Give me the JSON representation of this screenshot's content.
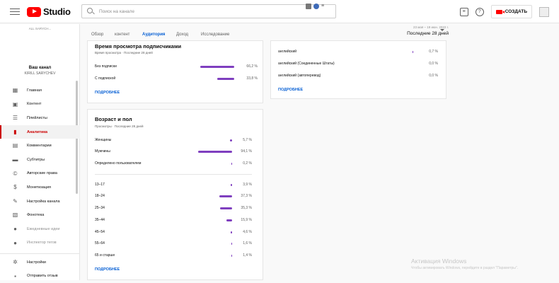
{
  "topbar": {
    "logo_text": "Studio",
    "search_placeholder": "Поиск на канале",
    "create_label": "СОЗДАТЬ"
  },
  "sidebar": {
    "banner_text": "ALL SARYCH...",
    "channel_title": "Ваш канал",
    "channel_name": "KIRILL SARYCHEV",
    "items": [
      {
        "label": "Главная",
        "icon": "dashboard-icon"
      },
      {
        "label": "Контент",
        "icon": "content-icon"
      },
      {
        "label": "Плейлисты",
        "icon": "playlist-icon"
      },
      {
        "label": "Аналитика",
        "icon": "analytics-icon",
        "active": true
      },
      {
        "label": "Комментарии",
        "icon": "comments-icon"
      },
      {
        "label": "Субтитры",
        "icon": "subtitles-icon"
      },
      {
        "label": "Авторские права",
        "icon": "copyright-icon"
      },
      {
        "label": "Монетизация",
        "icon": "monetization-icon"
      },
      {
        "label": "Настройка канала",
        "icon": "customization-icon"
      },
      {
        "label": "Фонотека",
        "icon": "audio-library-icon"
      },
      {
        "label": "Ежедневные идеи",
        "icon": "ideas-icon",
        "dim": true
      },
      {
        "label": "Инспектор тегов",
        "icon": "tag-inspector-icon",
        "dim": true
      }
    ],
    "bottom_items": [
      {
        "label": "Настройки",
        "icon": "settings-icon"
      },
      {
        "label": "Отправить отзыв",
        "icon": "feedback-icon"
      }
    ]
  },
  "tabs": [
    "Обзор",
    "контент",
    "Аудитория",
    "Доход",
    "Исследование"
  ],
  "active_tab": "Аудитория",
  "period": {
    "range": "23 мая – 19 июн. 2022 г.",
    "value": "Последние 28 дней"
  },
  "card_subscribers": {
    "title": "Время просмотра подписчиками",
    "subtitle": "Время просмотра · Последние 28 дней",
    "rows": [
      {
        "label": "Без подписки",
        "value": "66,2 %",
        "fraction": 0.662
      },
      {
        "label": "С подпиской",
        "value": "33,8 %",
        "fraction": 0.338
      }
    ],
    "more": "ПОДРОБНЕЕ"
  },
  "card_subtitles": {
    "rows": [
      {
        "label": "английский",
        "value": "0,7 %",
        "fraction": 0.007
      },
      {
        "label": "английский (Соединенные Штаты)",
        "value": "0,0 %",
        "fraction": 0.0
      },
      {
        "label": "английский (автоперевод)",
        "value": "0,0 %",
        "fraction": 0.0
      }
    ],
    "more": "ПОДРОБНЕЕ"
  },
  "card_age_gender": {
    "title": "Возраст и пол",
    "subtitle": "Просмотры · Последние 28 дней",
    "gender_rows": [
      {
        "label": "Женщины",
        "value": "5,7 %",
        "fraction": 0.057
      },
      {
        "label": "Мужчины",
        "value": "94,1 %",
        "fraction": 0.941
      },
      {
        "label": "Определено пользователем",
        "value": "0,2 %",
        "fraction": 0.002
      }
    ],
    "age_rows": [
      {
        "label": "13–17",
        "value": "3,9 %",
        "fraction": 0.039
      },
      {
        "label": "18–24",
        "value": "37,3 %",
        "fraction": 0.373
      },
      {
        "label": "25–34",
        "value": "35,3 %",
        "fraction": 0.353
      },
      {
        "label": "35–44",
        "value": "15,9 %",
        "fraction": 0.159
      },
      {
        "label": "45–54",
        "value": "4,6 %",
        "fraction": 0.046
      },
      {
        "label": "55–64",
        "value": "1,6 %",
        "fraction": 0.016
      },
      {
        "label": "65 и старше",
        "value": "1,4 %",
        "fraction": 0.014
      }
    ],
    "more": "ПОДРОБНЕЕ"
  },
  "watermark": {
    "line1": "Активация Windows",
    "line2": "Чтобы активировать Windows, перейдите в раздел \"Параметры\"."
  },
  "colors": {
    "accent": "#065fd4",
    "bar": "#7f3fbf",
    "active_nav": "#cc0000",
    "brand": "#ff0000"
  }
}
